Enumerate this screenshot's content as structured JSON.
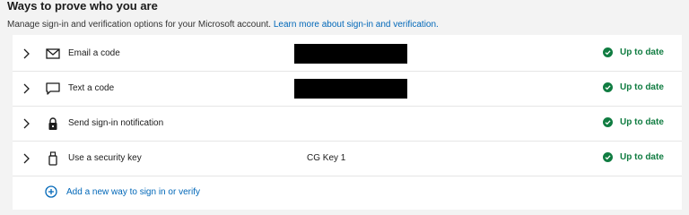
{
  "header": {
    "title": "Ways to prove who you are",
    "description": "Manage sign-in and verification options for your Microsoft account.",
    "learn_more": "Learn more about sign-in and verification."
  },
  "methods": [
    {
      "label": "Email a code",
      "icon": "envelope-icon",
      "value": "",
      "redacted": true,
      "status": "Up to date"
    },
    {
      "label": "Text a code",
      "icon": "chat-bubble-icon",
      "value": "",
      "redacted": true,
      "status": "Up to date"
    },
    {
      "label": "Send sign-in notification",
      "icon": "lock-icon",
      "value": "",
      "redacted": false,
      "status": "Up to date"
    },
    {
      "label": "Use a security key",
      "icon": "usb-key-icon",
      "value": "CG Key 1",
      "redacted": false,
      "status": "Up to date"
    }
  ],
  "add_method": {
    "label": "Add a new way to sign in or verify",
    "icon": "plus-circle-icon"
  },
  "colors": {
    "status_green": "#107c41",
    "link_blue": "#0067b8",
    "redaction": "#000000"
  }
}
